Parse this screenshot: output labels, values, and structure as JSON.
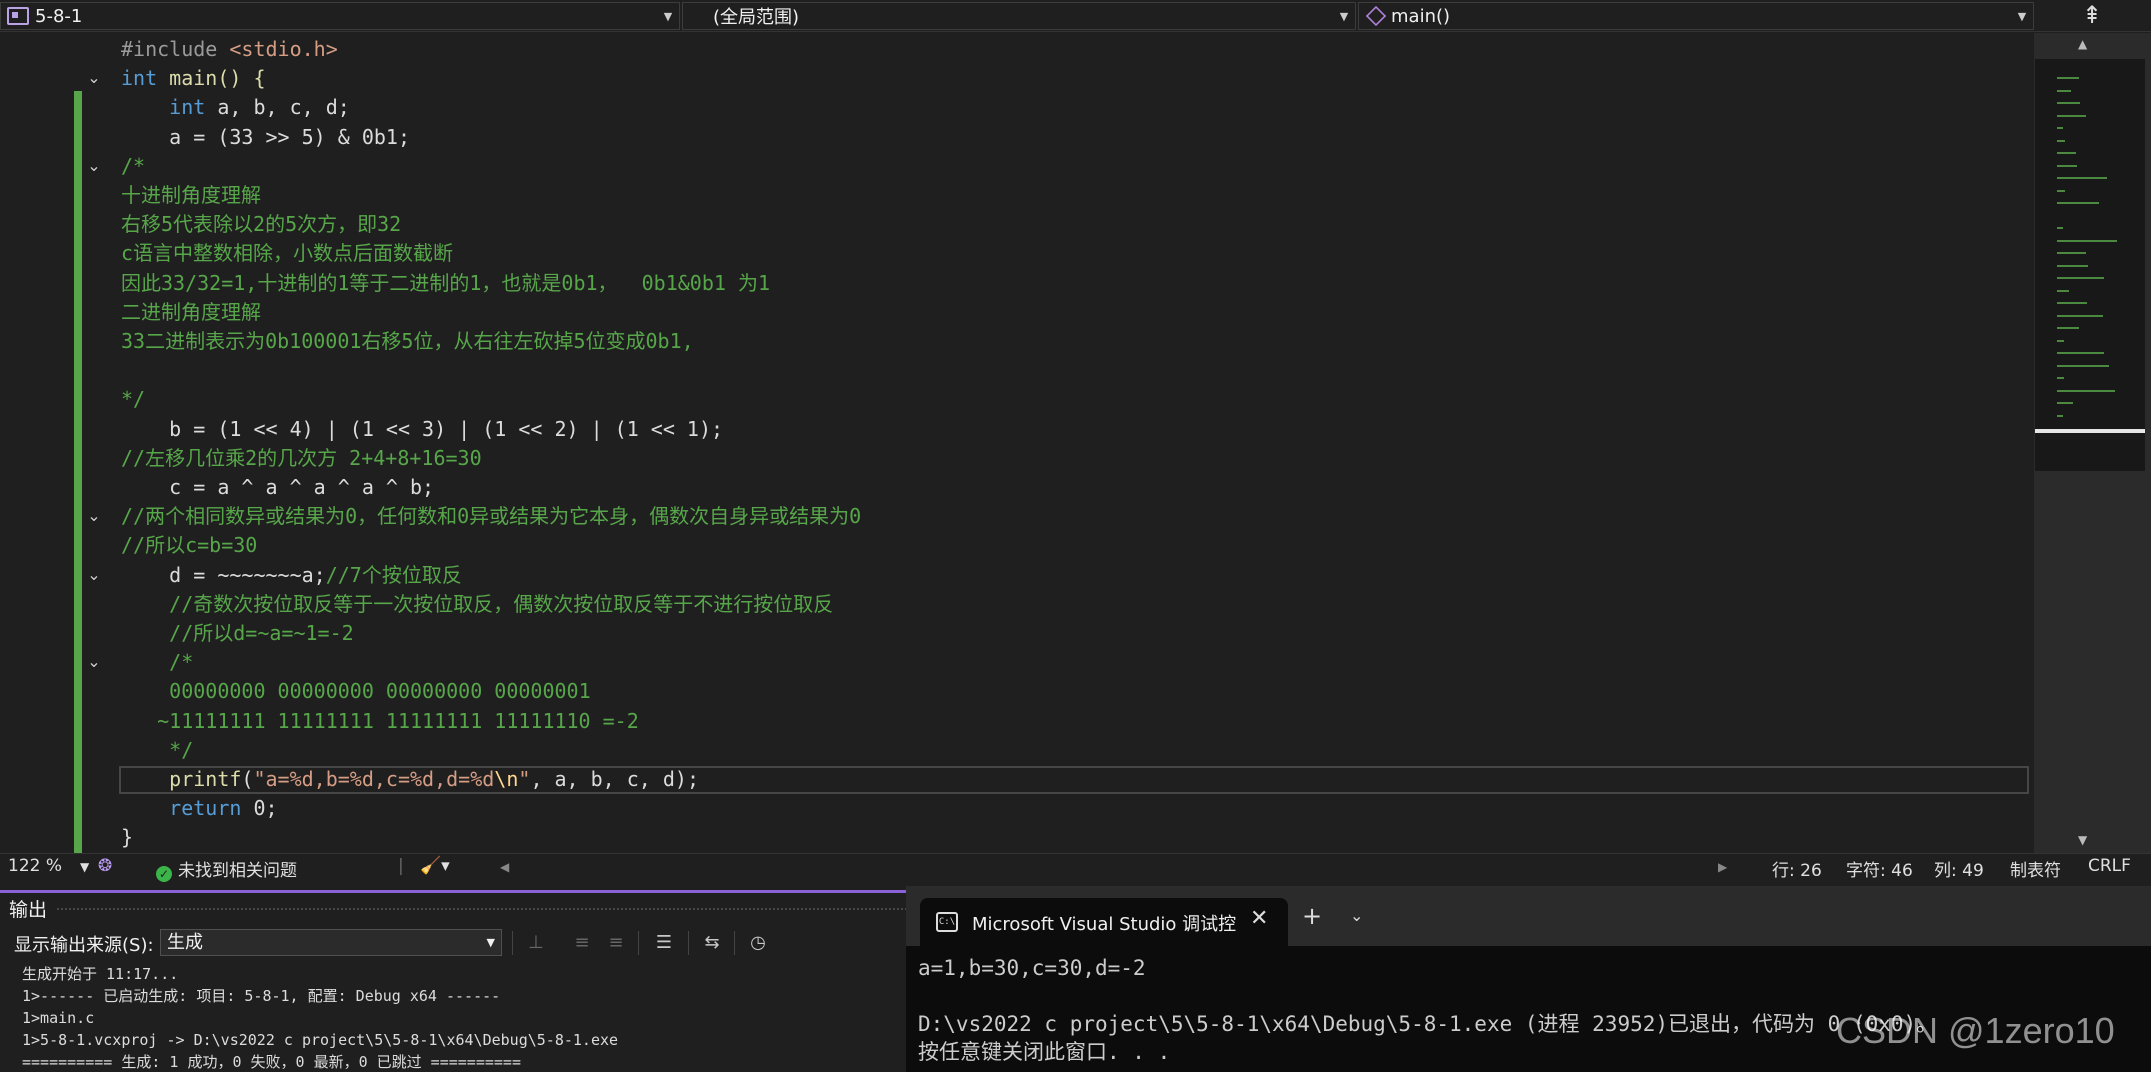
{
  "navbar": {
    "project": "5-8-1",
    "scope": "(全局范围)",
    "function": "main()"
  },
  "code_lines": [
    {
      "fold": "",
      "segs": [
        {
          "t": "#include ",
          "c": "pp"
        },
        {
          "t": "<stdio.h>",
          "c": "hdr"
        }
      ]
    },
    {
      "fold": "v",
      "segs": [
        {
          "t": "int",
          "c": "kw"
        },
        {
          "t": " main() {",
          "c": "fn"
        }
      ]
    },
    {
      "fold": "",
      "segs": [
        {
          "t": "    "
        },
        {
          "t": "int",
          "c": "kw"
        },
        {
          "t": " a, b, c, d;"
        }
      ]
    },
    {
      "fold": "",
      "segs": [
        {
          "t": "    a = (33 >> 5) & 0b1;"
        }
      ]
    },
    {
      "fold": "v",
      "segs": [
        {
          "t": "/*",
          "c": "cmt"
        }
      ]
    },
    {
      "fold": "",
      "segs": [
        {
          "t": "十进制角度理解",
          "c": "cmt"
        }
      ]
    },
    {
      "fold": "",
      "segs": [
        {
          "t": "右移5代表除以2的5次方，即32",
          "c": "cmt"
        }
      ]
    },
    {
      "fold": "",
      "segs": [
        {
          "t": "c语言中整数相除，小数点后面数截断",
          "c": "cmt"
        }
      ]
    },
    {
      "fold": "",
      "segs": [
        {
          "t": "因此33/32=1,十进制的1等于二进制的1，也就是0b1，  0b1&0b1 为1",
          "c": "cmt"
        }
      ]
    },
    {
      "fold": "",
      "segs": [
        {
          "t": "二进制角度理解",
          "c": "cmt"
        }
      ]
    },
    {
      "fold": "",
      "segs": [
        {
          "t": "33二进制表示为0b100001右移5位，从右往左砍掉5位变成0b1,",
          "c": "cmt"
        }
      ]
    },
    {
      "fold": "",
      "segs": [
        {
          "t": ""
        }
      ]
    },
    {
      "fold": "",
      "segs": [
        {
          "t": "*/",
          "c": "cmt"
        }
      ]
    },
    {
      "fold": "",
      "segs": [
        {
          "t": "    b = (1 << 4) | (1 << 3) | (1 << 2) | (1 << 1);"
        }
      ]
    },
    {
      "fold": "",
      "segs": [
        {
          "t": "//左移几位乘2的几次方 2+4+8+16=30",
          "c": "cmt"
        }
      ]
    },
    {
      "fold": "",
      "segs": [
        {
          "t": "    c = a ^ a ^ a ^ a ^ b;"
        }
      ]
    },
    {
      "fold": "v",
      "segs": [
        {
          "t": "//两个相同数异或结果为0，任何数和0异或结果为它本身，偶数次自身异或结果为0",
          "c": "cmt"
        }
      ]
    },
    {
      "fold": "",
      "segs": [
        {
          "t": "//所以c=b=30",
          "c": "cmt"
        }
      ]
    },
    {
      "fold": "v",
      "segs": [
        {
          "t": "    d = ~~~~~~~a;"
        },
        {
          "t": "//7个按位取反",
          "c": "cmt"
        }
      ]
    },
    {
      "fold": "",
      "segs": [
        {
          "t": "    "
        },
        {
          "t": "//奇数次按位取反等于一次按位取反，偶数次按位取反等于不进行按位取反",
          "c": "cmt"
        }
      ]
    },
    {
      "fold": "",
      "segs": [
        {
          "t": "    "
        },
        {
          "t": "//所以d=~a=~1=-2",
          "c": "cmt"
        }
      ]
    },
    {
      "fold": "v",
      "segs": [
        {
          "t": "    "
        },
        {
          "t": "/*",
          "c": "cmt"
        }
      ]
    },
    {
      "fold": "",
      "segs": [
        {
          "t": "    "
        },
        {
          "t": "00000000 00000000 00000000 00000001",
          "c": "cmt"
        }
      ]
    },
    {
      "fold": "",
      "segs": [
        {
          "t": "   "
        },
        {
          "t": "~11111111 11111111 11111111 11111110 =-2",
          "c": "cmt"
        }
      ]
    },
    {
      "fold": "",
      "segs": [
        {
          "t": "    "
        },
        {
          "t": "*/",
          "c": "cmt"
        }
      ]
    },
    {
      "fold": "",
      "segs": [
        {
          "t": "    "
        },
        {
          "t": "printf",
          "c": "fn"
        },
        {
          "t": "("
        },
        {
          "t": "\"a=%d,b=%d,c=%d,d=%d",
          "c": "str"
        },
        {
          "t": "\\n",
          "c": "esc"
        },
        {
          "t": "\"",
          "c": "str"
        },
        {
          "t": ", a, b, c, d);"
        }
      ]
    },
    {
      "fold": "",
      "segs": [
        {
          "t": "    "
        },
        {
          "t": "return",
          "c": "kw"
        },
        {
          "t": " 0;"
        }
      ]
    },
    {
      "fold": "",
      "segs": [
        {
          "t": "}"
        }
      ]
    }
  ],
  "status": {
    "zoom": "122 %",
    "issues": "未找到相关问题",
    "line": "行: 26",
    "char": "字符: 46",
    "col": "列: 49",
    "tabs": "制表符",
    "eol": "CRLF"
  },
  "output": {
    "title": "输出",
    "source_label": "显示输出来源(S):",
    "source_value": "生成",
    "lines": [
      "生成开始于 11:17...",
      "1>------ 已启动生成: 项目: 5-8-1, 配置: Debug x64 ------",
      "1>main.c",
      "1>5-8-1.vcxproj -> D:\\vs2022 c project\\5\\5-8-1\\x64\\Debug\\5-8-1.exe",
      "========== 生成: 1 成功，0 失败，0 最新，0 已跳过 =========="
    ]
  },
  "console": {
    "tab_title": "Microsoft Visual Studio 调试控制台",
    "lines": [
      "a=1,b=30,c=30,d=-2",
      "",
      "D:\\vs2022 c project\\5\\5-8-1\\x64\\Debug\\5-8-1.exe (进程 23952)已退出，代码为 0 (0x0)。",
      "按任意键关闭此窗口. . ."
    ]
  },
  "watermark": "CSDN @1zero10",
  "icons": {
    "split": "split-editor-icon",
    "ok": "check-circle-icon",
    "terminal": "terminal-icon"
  },
  "colors": {
    "accent": "#8862d6",
    "comment": "#57a64a",
    "keyword": "#569cd6",
    "string": "#d69d85",
    "changebar": "#57a64a"
  }
}
